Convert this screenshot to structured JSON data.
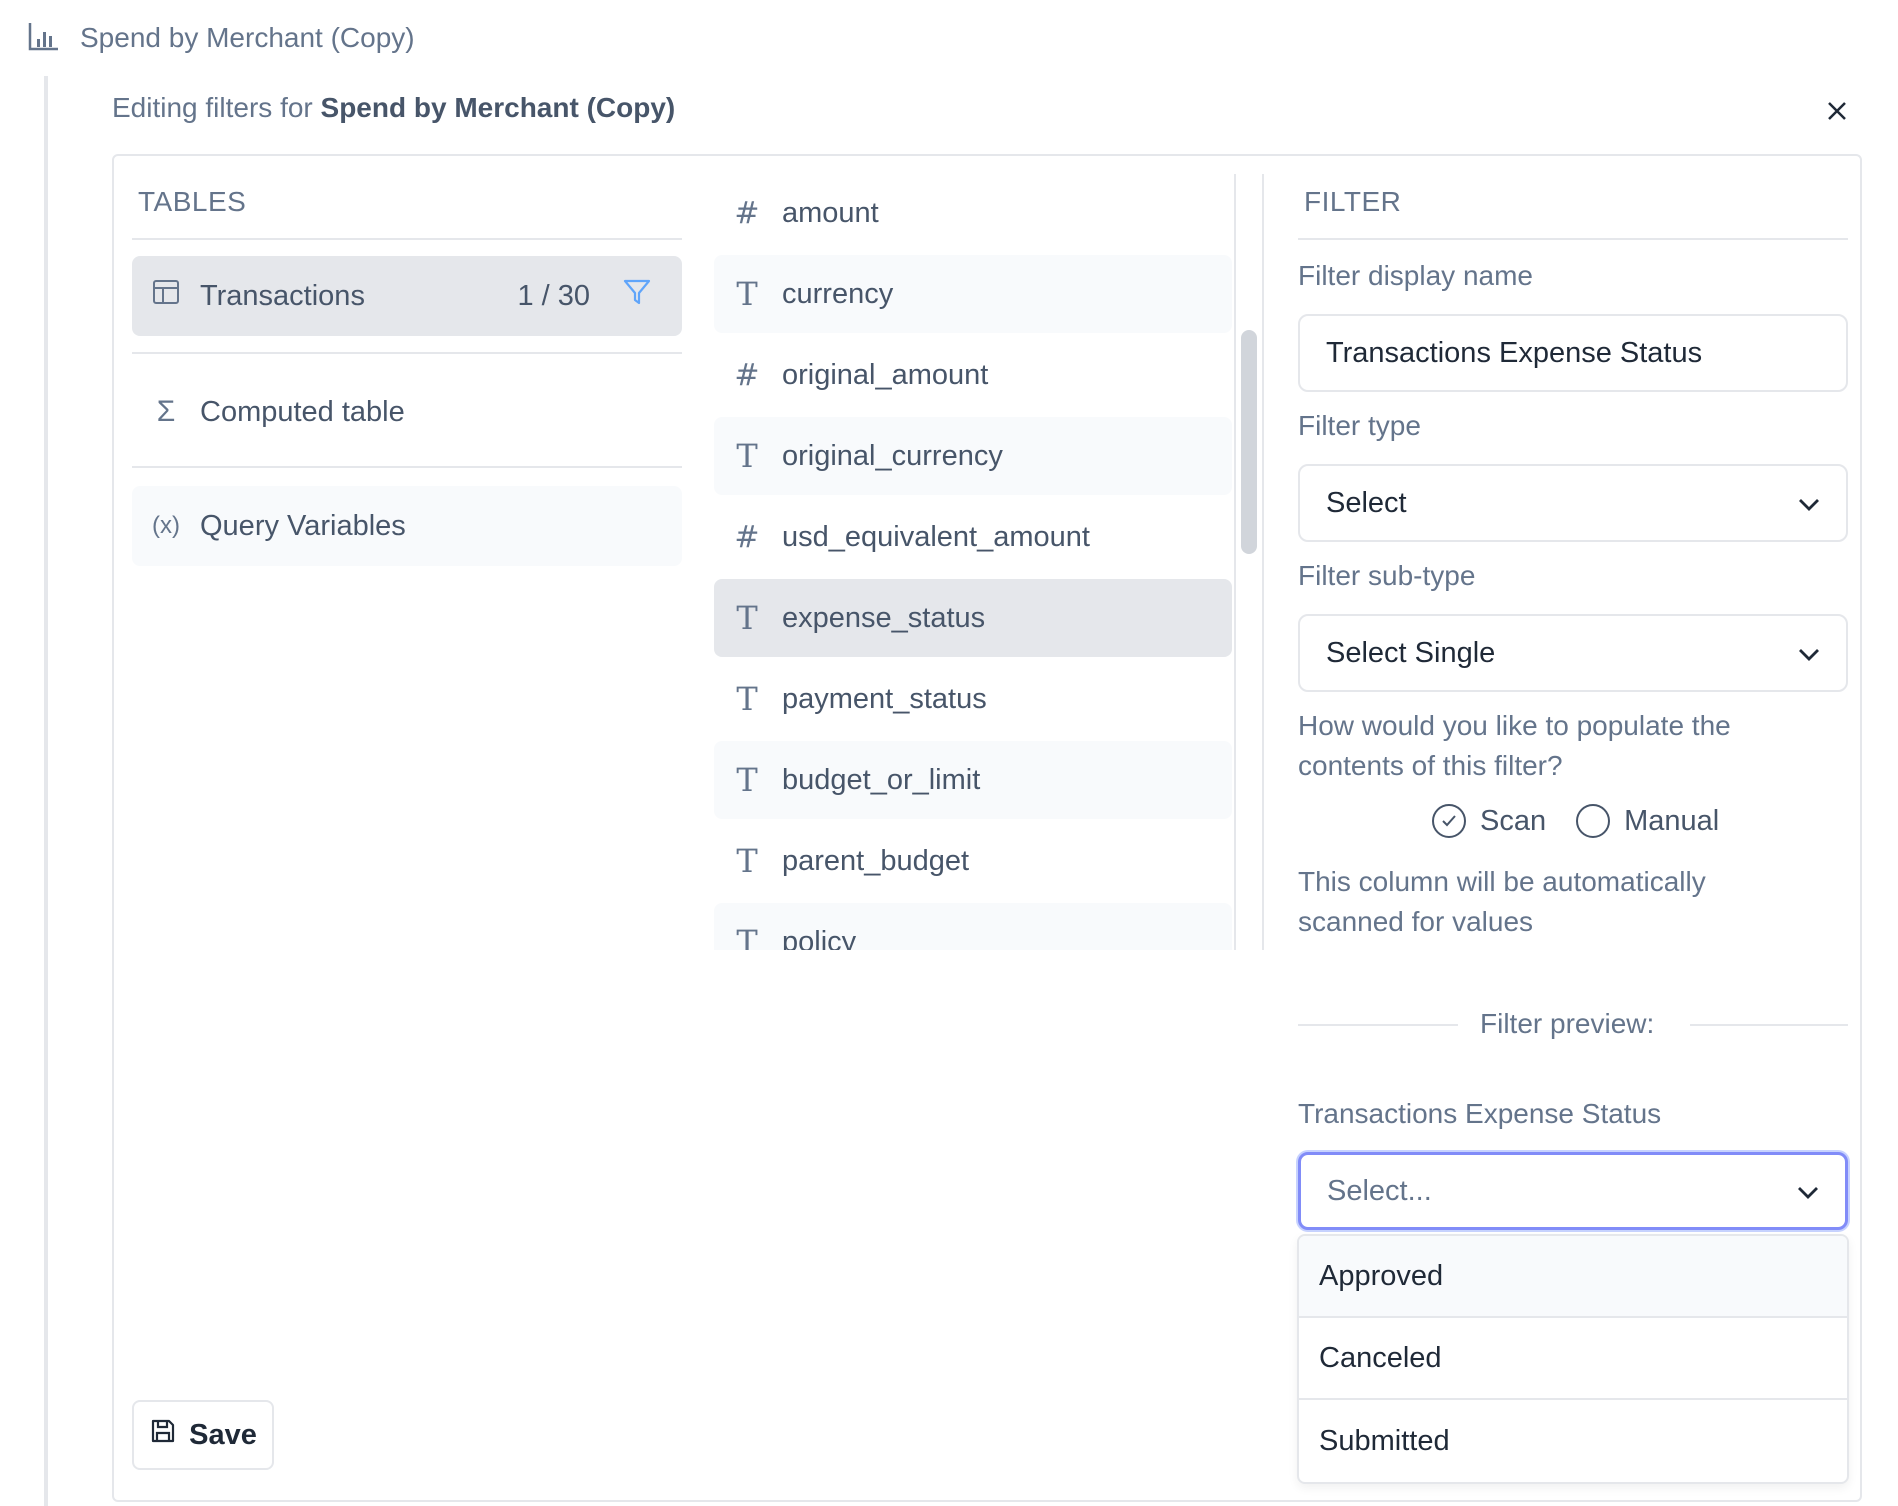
{
  "header": {
    "title": "Spend by Merchant (Copy)",
    "icon": "bar-chart-icon"
  },
  "editor": {
    "prefix": "Editing filters for",
    "chart_name": "Spend by Merchant (Copy)"
  },
  "tables": {
    "heading": "TABLES",
    "items": [
      {
        "label": "Transactions",
        "count": "1 / 30",
        "icon": "table-icon"
      },
      {
        "label": "Computed table",
        "icon": "sigma-icon"
      },
      {
        "label": "Query Variables",
        "icon": "variable-icon"
      }
    ]
  },
  "columns": [
    {
      "name": "amount",
      "type": "#"
    },
    {
      "name": "currency",
      "type": "T"
    },
    {
      "name": "original_amount",
      "type": "#"
    },
    {
      "name": "original_currency",
      "type": "T"
    },
    {
      "name": "usd_equivalent_amount",
      "type": "#"
    },
    {
      "name": "expense_status",
      "type": "T"
    },
    {
      "name": "payment_status",
      "type": "T"
    },
    {
      "name": "budget_or_limit",
      "type": "T"
    },
    {
      "name": "parent_budget",
      "type": "T"
    },
    {
      "name": "policy",
      "type": "T"
    }
  ],
  "filter": {
    "heading": "FILTER",
    "display_name_label": "Filter display name",
    "display_name_value": "Transactions Expense Status",
    "type_label": "Filter type",
    "type_value": "Select",
    "subtype_label": "Filter sub-type",
    "subtype_value": "Select Single",
    "populate_question": "How would you like to populate the contents of this filter?",
    "option_scan": "Scan",
    "option_manual": "Manual",
    "scan_note": "This column will be automatically scanned for values",
    "preview_label": "Filter preview:",
    "preview_field_label": "Transactions Expense Status",
    "preview_placeholder": "Select...",
    "preview_options": [
      "Approved",
      "Canceled",
      "Submitted"
    ]
  },
  "save_label": "Save",
  "colors": {
    "accent": "#818cf8",
    "filter_icon": "#60a5fa",
    "selected_bg": "#e5e7eb"
  }
}
